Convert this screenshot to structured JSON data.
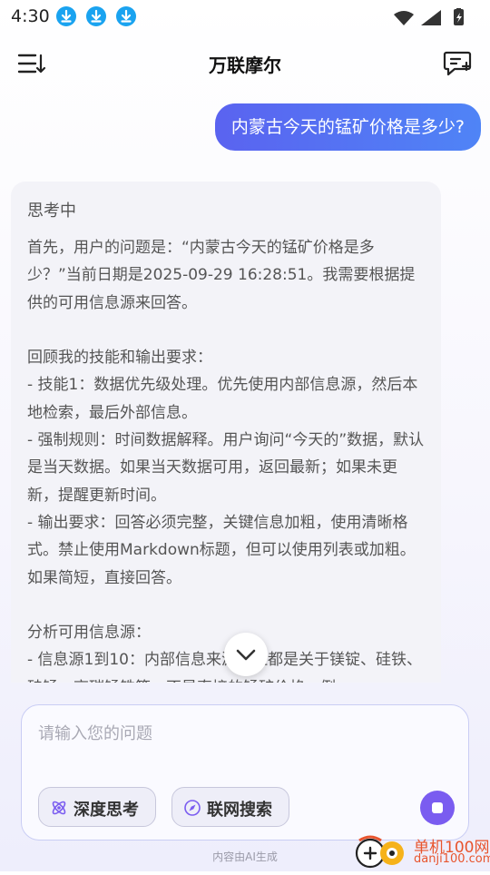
{
  "status_bar": {
    "time": "4:30"
  },
  "header": {
    "title": "万联摩尔"
  },
  "conversation": {
    "user_message": "内蒙古今天的锰矿价格是多少?",
    "thinking": {
      "status": "思考中",
      "text": "首先，用户的问题是：“内蒙古今天的锰矿价格是多少？”当前日期是2025-09-29 16:28:51。我需要根据提供的可用信息源来回答。\n\n回顾我的技能和输出要求：\n- 技能1：数据优先级处理。优先使用内部信息源，然后本地检索，最后外部信息。\n- 强制规则：时间数据解释。用户询问“今天的”数据，默认是当天数据。如果当天数据可用，返回最新；如果未更新，提醒更新时间。\n- 输出要求：回答必须完整，关键信息加粗，使用清晰格式。禁止使用Markdown标题，但可以使用列表或加粗。如果简短，直接回答。\n\n分析可用信息源：\n- 信息源1到10：内部信息来源，但都是关于镁锭、硅铁、硅锰、高碳锰铁等，不是直接的锰矿价格。例"
    }
  },
  "input": {
    "placeholder": "请输入您的问题",
    "value": "",
    "deep_think_label": "深度思考",
    "web_search_label": "联网搜索",
    "disclaimer": "内容由AI生成"
  },
  "watermark": {
    "text": "单机100网",
    "url": "danji100.com"
  },
  "colors": {
    "accent": "#5a63f0",
    "stop_button": "#7a5cf0",
    "download_icon": "#1aa3f0"
  }
}
